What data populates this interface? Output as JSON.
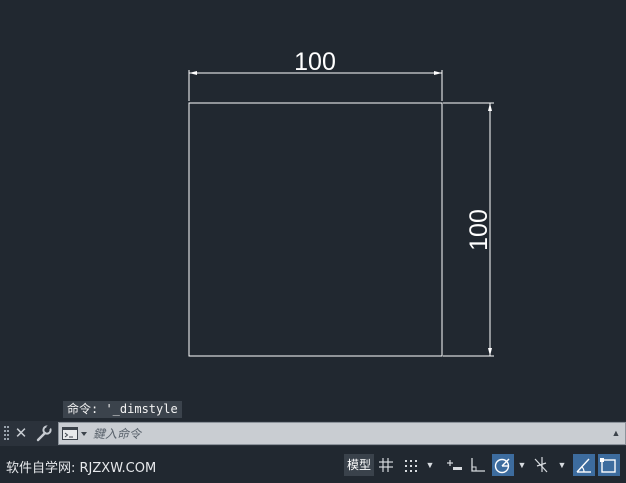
{
  "drawing": {
    "horizontal_dimension": "100",
    "vertical_dimension": "100"
  },
  "command": {
    "history_text": "命令: '_dimstyle",
    "input_placeholder": "鍵入命令"
  },
  "status": {
    "watermark": "软件自学网: RJZXW.COM",
    "model_tab": "模型"
  },
  "colors": {
    "background": "#212830",
    "geometry": "#ffffff",
    "active_toggle": "#3d6c9e"
  },
  "icons": [
    "close-icon",
    "wrench-icon",
    "command-prompt-icon",
    "grid-icon",
    "snap-icon",
    "infer-constraints-icon",
    "ortho-icon",
    "polar-tracking-icon",
    "isodraft-icon",
    "dynamic-ucs-icon",
    "selection-cycling-icon"
  ]
}
